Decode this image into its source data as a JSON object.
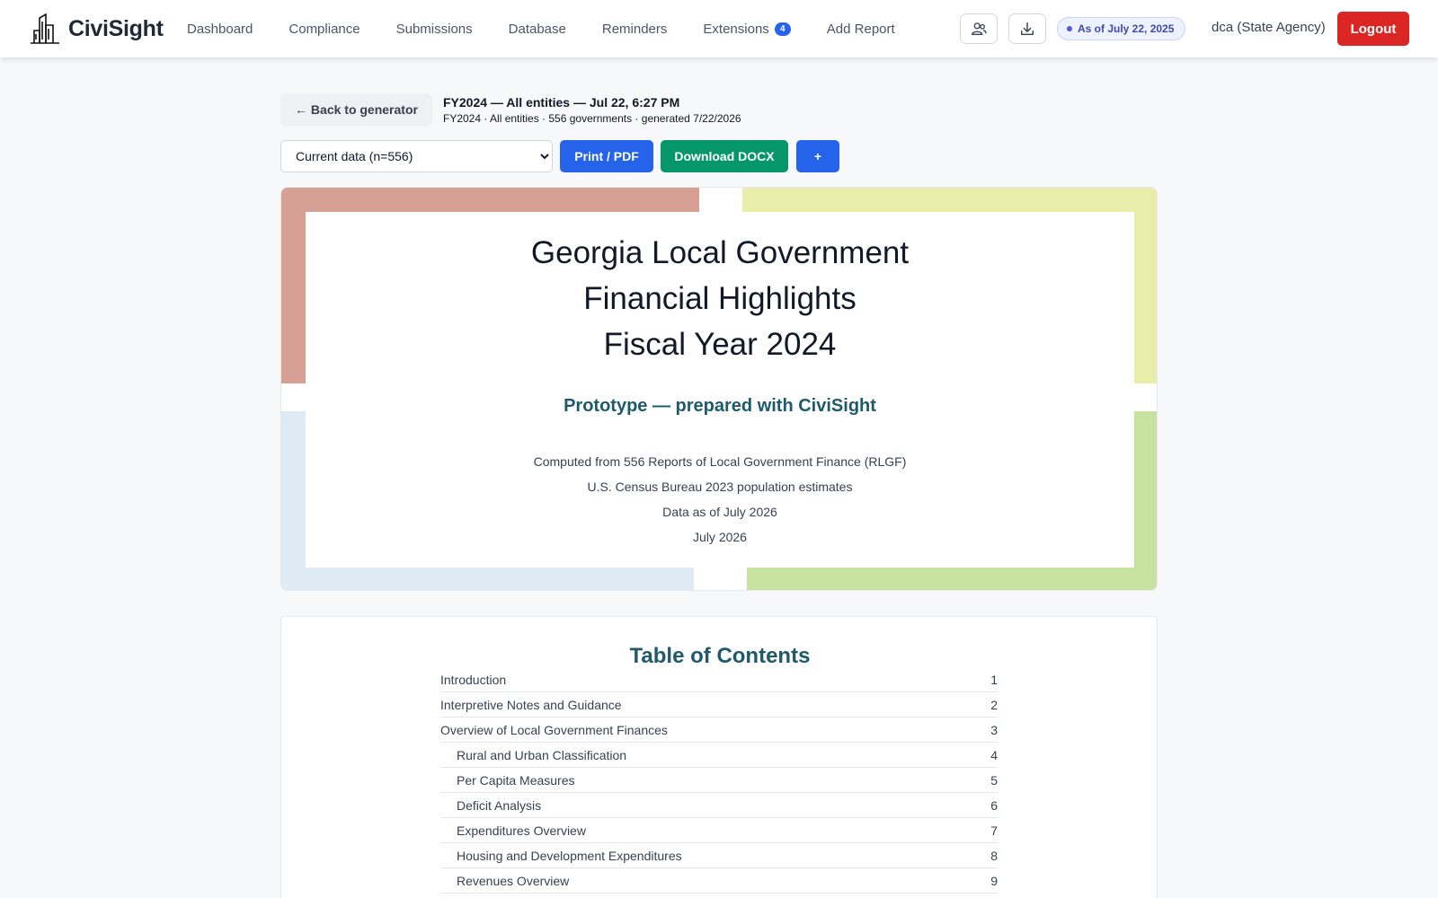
{
  "brand": {
    "name": "CiviSight"
  },
  "nav": {
    "links": [
      {
        "label": "Dashboard"
      },
      {
        "label": "Compliance"
      },
      {
        "label": "Submissions"
      },
      {
        "label": "Database"
      },
      {
        "label": "Reminders"
      },
      {
        "label": "Extensions",
        "badge": "4"
      },
      {
        "label": "Add Report"
      }
    ],
    "icons": [
      "users-icon",
      "download-icon"
    ],
    "as_of": "As of July 22, 2025",
    "user": "dca (State Agency)",
    "logout": "Logout"
  },
  "header": {
    "back_label": "← Back to generator",
    "title": "FY2024 — All entities — Jul 22, 6:27 PM",
    "subtitle": "FY2024 · All entities · 556 governments · generated 7/22/2026"
  },
  "toolbar": {
    "selected_data": "Current data (n=556)",
    "print_label": "Print / PDF",
    "docx_label": "Download DOCX",
    "plus_label": "+"
  },
  "cover": {
    "title_lines": [
      "Georgia Local Government",
      "Financial Highlights",
      "Fiscal Year 2024"
    ],
    "prototype": "Prototype — prepared with CiviSight",
    "lines": [
      "Computed from 556 Reports of Local Government Finance (RLGF)",
      "U.S. Census Bureau 2023 population estimates",
      "Data as of July 2026",
      "July 2026"
    ],
    "colors": {
      "top_left": "#d6a095",
      "top_right": "#e8eeaa",
      "bottom_left": "#deebf4",
      "bottom_right": "#c7e19e"
    }
  },
  "toc": {
    "heading": "Table of Contents",
    "rows": [
      {
        "label": "Introduction",
        "page": "1"
      },
      {
        "label": "Interpretive Notes and Guidance",
        "page": "2"
      },
      {
        "label": "Overview of Local Government Finances",
        "page": "3"
      },
      {
        "label": "Rural and Urban Classification",
        "page": "4"
      },
      {
        "label": "Per Capita Measures",
        "page": "5"
      },
      {
        "label": "Deficit Analysis",
        "page": "6"
      },
      {
        "label": "Expenditures Overview",
        "page": "7"
      },
      {
        "label": "Housing and Development Expenditures",
        "page": "8"
      },
      {
        "label": "Revenues Overview",
        "page": "9"
      }
    ]
  }
}
